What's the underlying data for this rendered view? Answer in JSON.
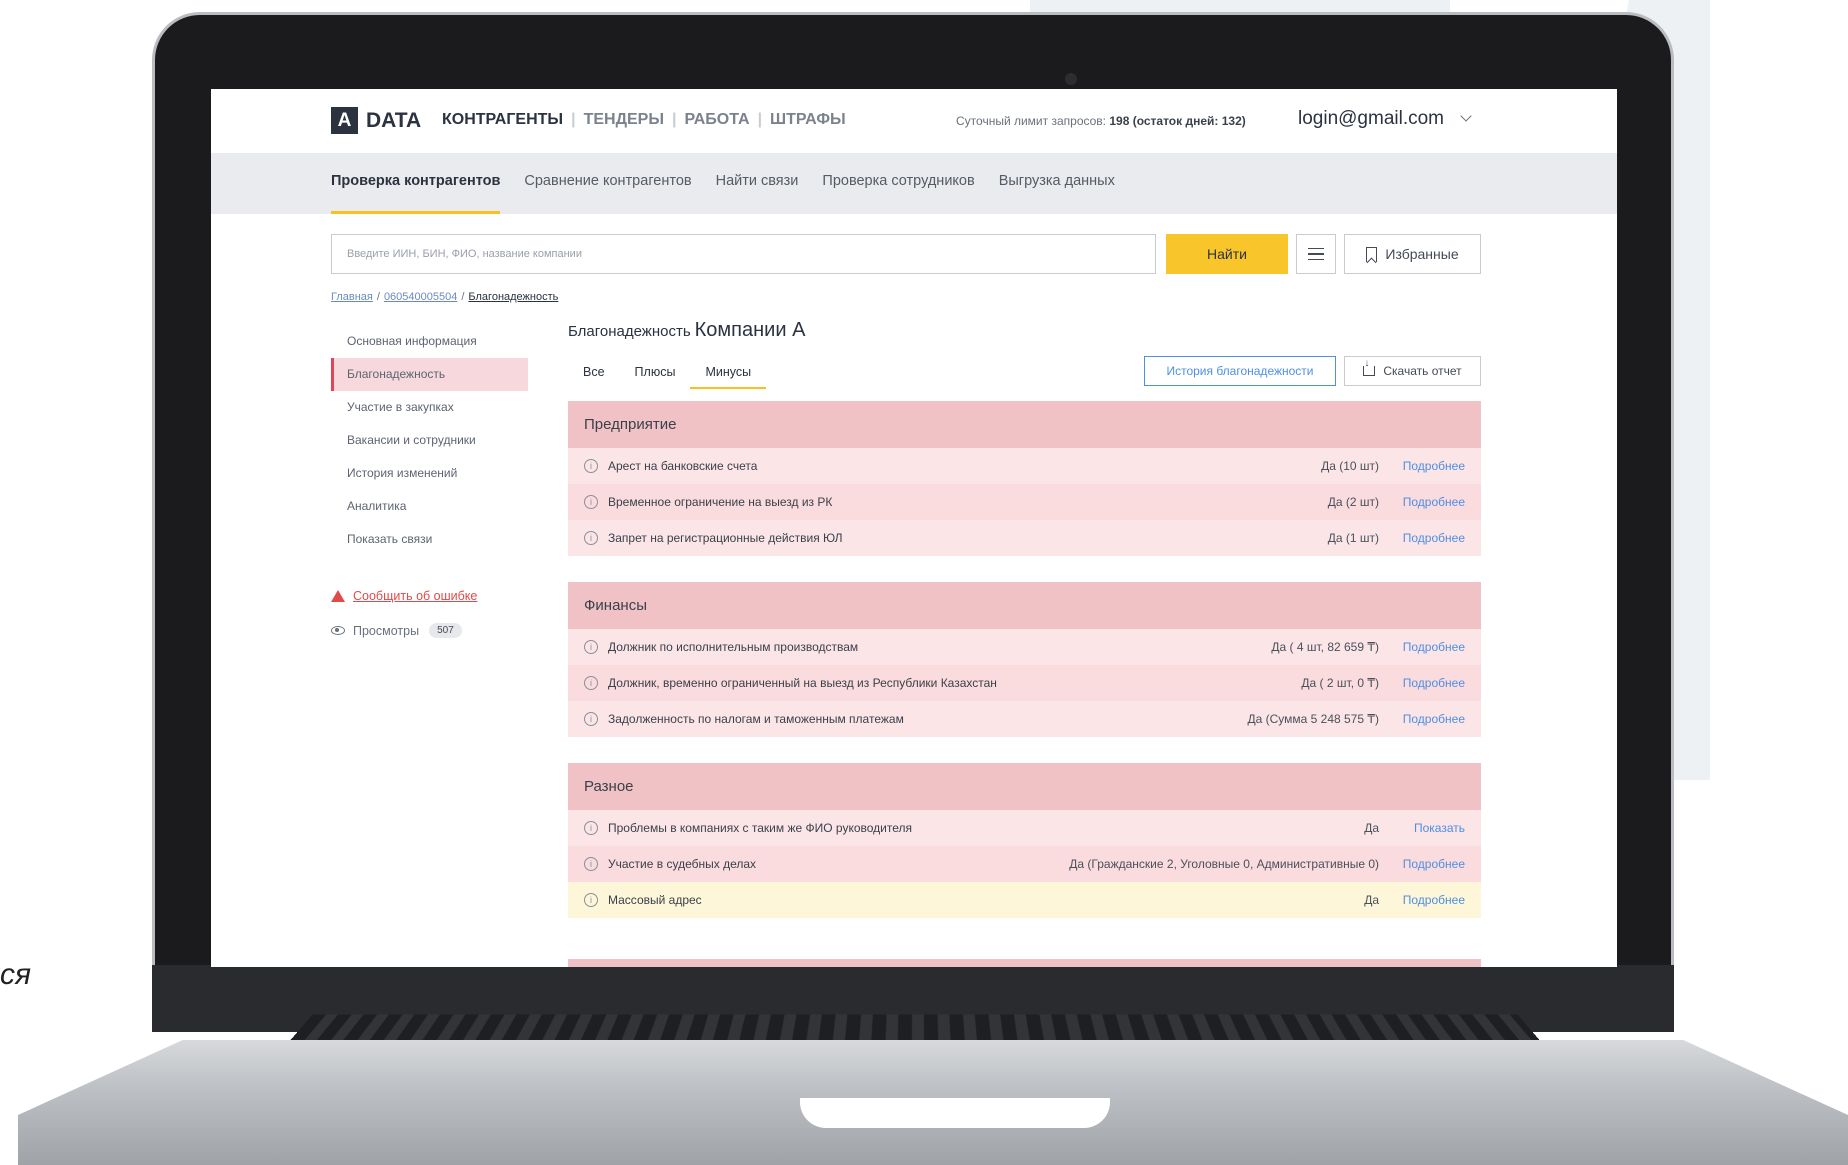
{
  "side_text": "ся",
  "header": {
    "logo_letter": "A",
    "logo_text": "DATA",
    "nav": [
      "КОНТРАГЕНТЫ",
      "ТЕНДЕРЫ",
      "РАБОТА",
      "ШТРАФЫ"
    ],
    "limit_prefix": "Суточный лимит запросов: ",
    "limit_value": "198 (остаток дней: 132)",
    "login": "login@gmail.com"
  },
  "subnav": {
    "items": [
      "Проверка контрагентов",
      "Сравнение контрагентов",
      "Найти связи",
      "Проверка сотрудников",
      "Выгрузка данных"
    ]
  },
  "search": {
    "placeholder": "Введите ИИН, БИН, ФИО, название компании",
    "find_label": "Найти",
    "favorites_label": "Избранные"
  },
  "breadcrumb": {
    "home": "Главная",
    "id": "060540005504",
    "current": "Благонадежность",
    "sep": "/"
  },
  "sidebar": {
    "items": [
      "Основная информация",
      "Благонадежность",
      "Участие в закупках",
      "Вакансии и сотрудники",
      "История изменений",
      "Аналитика",
      "Показать связи"
    ],
    "report_label": "Сообщить об ошибке",
    "views_label": "Просмотры",
    "views_count": "507"
  },
  "main": {
    "title_prefix": "Благонадежность",
    "title_company": "Компании А",
    "tabs": [
      "Все",
      "Плюсы",
      "Минусы"
    ],
    "history_button": "История благонадежности",
    "download_button": "Скачать отчет"
  },
  "sections": [
    {
      "title": "Предприятие",
      "rows": [
        {
          "label": "Арест на банковские счета",
          "value": "Да (10 шт)",
          "link": "Подробнее"
        },
        {
          "label": "Временное ограничение на выезд из РК",
          "value": "Да (2 шт)",
          "link": "Подробнее"
        },
        {
          "label": "Запрет на регистрационные действия ЮЛ",
          "value": "Да (1 шт)",
          "link": "Подробнее"
        }
      ]
    },
    {
      "title": "Финансы",
      "rows": [
        {
          "label": "Должник по исполнительным производствам",
          "value": "Да ( 4 шт, 82 659 ₸)",
          "link": "Подробнее"
        },
        {
          "label": "Должник, временно ограниченный на выезд из Республики Казахстан",
          "value": "Да ( 2 шт, 0 ₸)",
          "link": "Подробнее"
        },
        {
          "label": "Задолженность по налогам и таможенным платежам",
          "value": "Да (Сумма 5 248 575 ₸)",
          "link": "Подробнее"
        }
      ]
    },
    {
      "title": "Разное",
      "rows": [
        {
          "label": "Проблемы в компаниях с таким же ФИО руководителя",
          "value": "Да",
          "link": "Показать"
        },
        {
          "label": "Участие в судебных делах",
          "value": "Да (Гражданские 2, Уголовные 0, Административные 0)",
          "link": "Подробнее"
        },
        {
          "label": "Массовый адрес",
          "value": "Да",
          "link": "Подробнее"
        }
      ]
    }
  ],
  "colors": {
    "accent_yellow": "#f8c52a",
    "link_blue": "#4e8fe3",
    "section_pink": "#f0c2c6",
    "warning_red": "#e24a4a"
  }
}
